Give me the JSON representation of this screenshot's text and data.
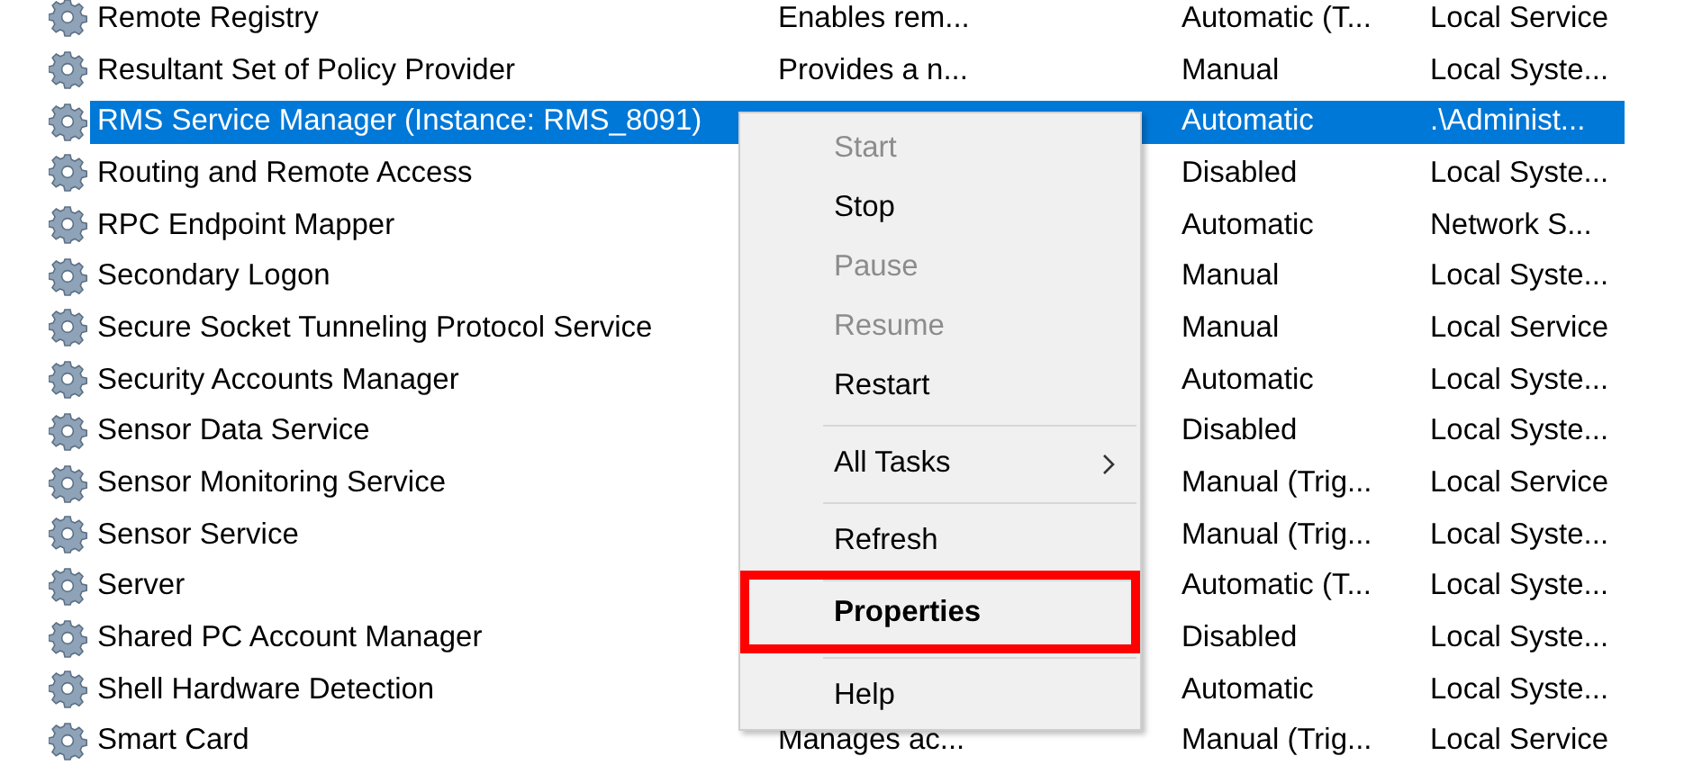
{
  "services": {
    "rows": [
      {
        "name": "Remote Registry",
        "description": "Enables rem...",
        "startup_type": "Automatic (T...",
        "log_on_as": "Local Service",
        "selected": false
      },
      {
        "name": "Resultant Set of Policy Provider",
        "description": "Provides a n...",
        "startup_type": "Manual",
        "log_on_as": "Local Syste...",
        "selected": false
      },
      {
        "name": "RMS Service Manager (Instance: RMS_8091)",
        "startup_type": "Automatic",
        "log_on_as": ".\\Administ...",
        "selected": true
      },
      {
        "name": "Routing and Remote Access",
        "startup_type": "Disabled",
        "log_on_as": "Local Syste...",
        "selected": false
      },
      {
        "name": "RPC Endpoint Mapper",
        "startup_type": "Automatic",
        "log_on_as": "Network S...",
        "selected": false
      },
      {
        "name": "Secondary Logon",
        "startup_type": "Manual",
        "log_on_as": "Local Syste...",
        "selected": false
      },
      {
        "name": "Secure Socket Tunneling Protocol Service",
        "startup_type": "Manual",
        "log_on_as": "Local Service",
        "selected": false
      },
      {
        "name": "Security Accounts Manager",
        "startup_type": "Automatic",
        "log_on_as": "Local Syste...",
        "selected": false
      },
      {
        "name": "Sensor Data Service",
        "startup_type": "Disabled",
        "log_on_as": "Local Syste...",
        "selected": false
      },
      {
        "name": "Sensor Monitoring Service",
        "startup_type": "Manual (Trig...",
        "log_on_as": "Local Service",
        "selected": false
      },
      {
        "name": "Sensor Service",
        "startup_type": "Manual (Trig...",
        "log_on_as": "Local Syste...",
        "selected": false
      },
      {
        "name": "Server",
        "startup_type": "Automatic (T...",
        "log_on_as": "Local Syste...",
        "selected": false
      },
      {
        "name": "Shared PC Account Manager",
        "startup_type": "Disabled",
        "log_on_as": "Local Syste...",
        "selected": false
      },
      {
        "name": "Shell Hardware Detection",
        "startup_type": "Automatic",
        "log_on_as": "Local Syste...",
        "selected": false
      },
      {
        "name": "Smart Card",
        "description": "Manages ac...",
        "startup_type": "Manual (Trig...",
        "log_on_as": "Local Service",
        "selected": false
      }
    ]
  },
  "context_menu": {
    "items": [
      {
        "kind": "item",
        "label": "Start",
        "disabled": true
      },
      {
        "kind": "item",
        "label": "Stop",
        "disabled": false
      },
      {
        "kind": "item",
        "label": "Pause",
        "disabled": true
      },
      {
        "kind": "item",
        "label": "Resume",
        "disabled": true
      },
      {
        "kind": "item",
        "label": "Restart",
        "disabled": false
      },
      {
        "kind": "separator"
      },
      {
        "kind": "item",
        "label": "All Tasks",
        "disabled": false,
        "submenu": true
      },
      {
        "kind": "separator"
      },
      {
        "kind": "item",
        "label": "Refresh",
        "disabled": false
      },
      {
        "kind": "separator"
      },
      {
        "kind": "item",
        "label": "Properties",
        "disabled": false,
        "default": true,
        "highlighted": true
      },
      {
        "kind": "separator"
      },
      {
        "kind": "item",
        "label": "Help",
        "disabled": false
      }
    ]
  }
}
